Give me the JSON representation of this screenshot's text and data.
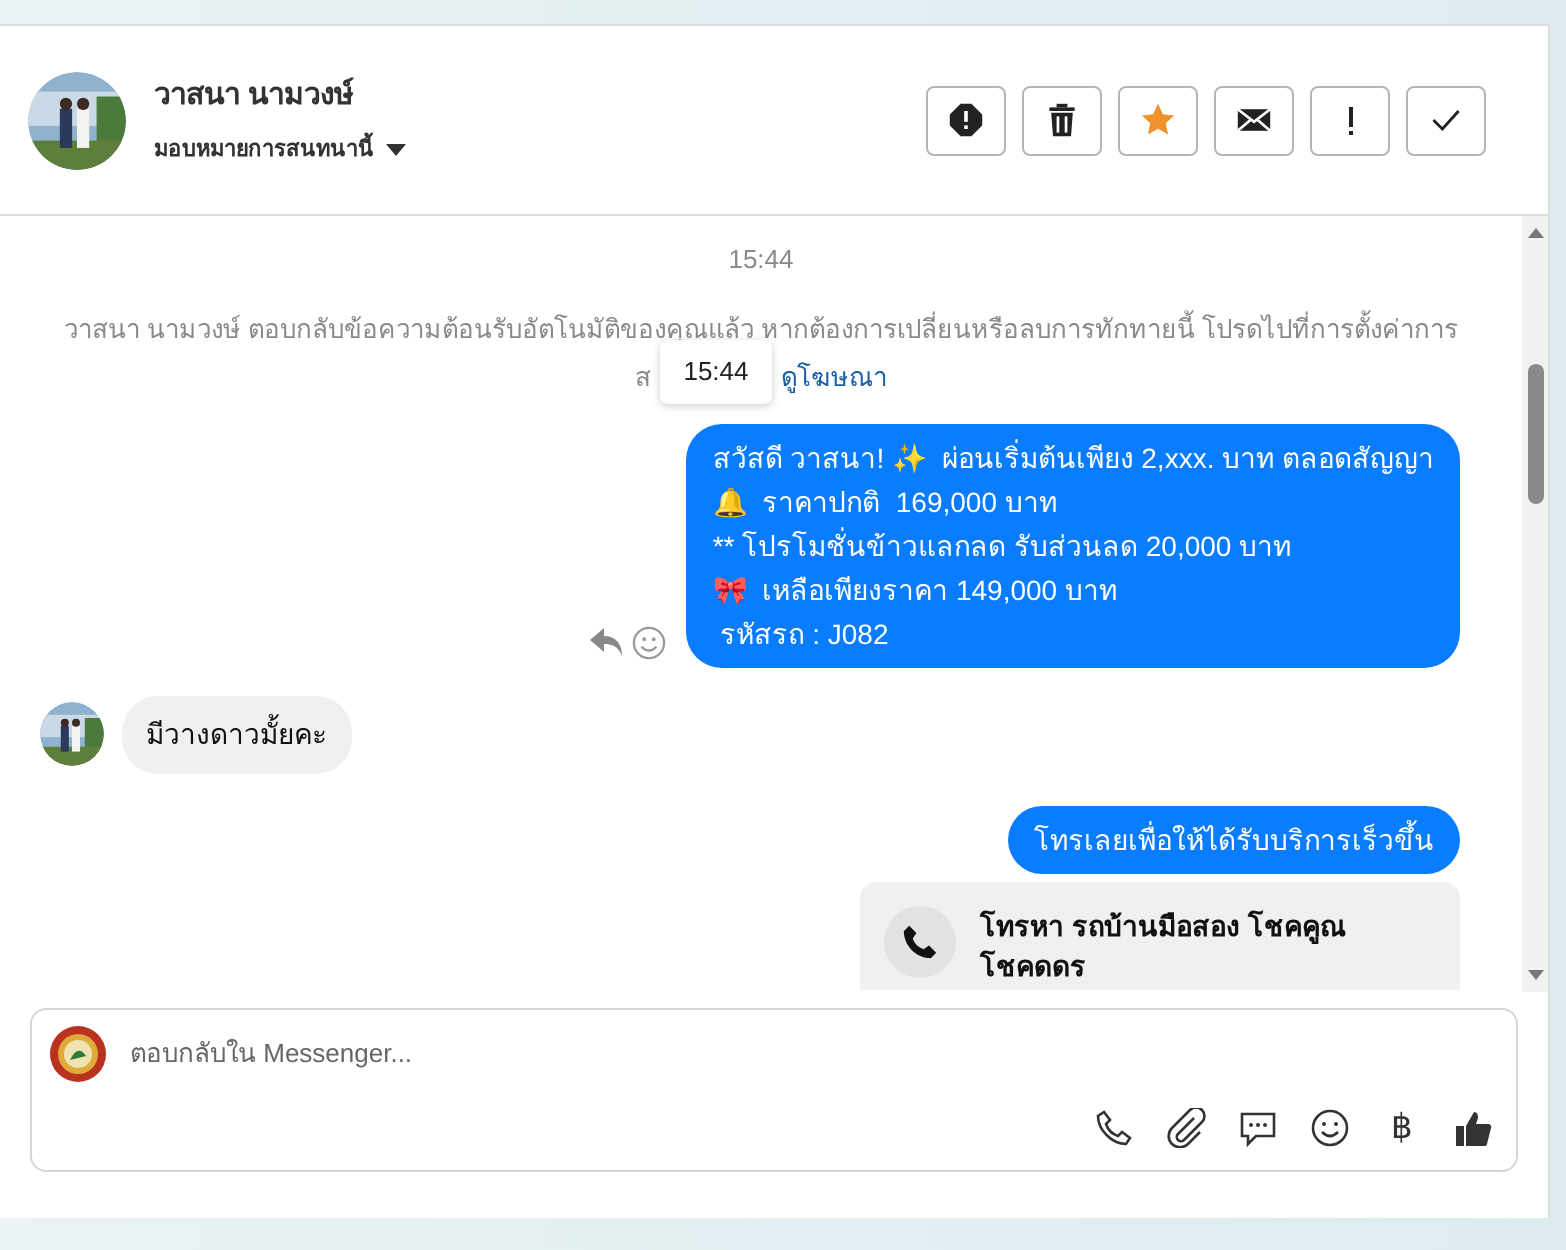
{
  "header": {
    "name": "วาสนา นามวงษ์",
    "assign": "มอบหมายการสนทนานี้",
    "actions": [
      {
        "kind": "report"
      },
      {
        "kind": "trash"
      },
      {
        "kind": "star"
      },
      {
        "kind": "mail"
      },
      {
        "kind": "important"
      },
      {
        "kind": "done"
      }
    ]
  },
  "chat": {
    "timestamp": "15:44",
    "notice": {
      "line1": "วาสนา นามวงษ์ ตอบกลับข้อความต้อนรับอัตโนมัติของคุณแล้ว หากต้องการเปลี่ยนหรือลบการทักทายนี้ โปรดไปที่การตั้งค่าการ",
      "line2_start": "ส",
      "link": "ดูโฆษณา",
      "tooltip": "15:44"
    },
    "messages": [
      {
        "kind": "outgoing",
        "lines": [
          "สวัสดี วาสนา! ✨  ผ่อนเริ่มต้นเพียง 2,xxx. บาท ตลอดสัญญา",
          "🔔  ราคาปกติ  169,000 บาท",
          "** โปรโมชั่นข้าวแลกลด รับส่วนลด 20,000 บาท",
          "🎀  เหลือเพียงราคา 149,000 บาท",
          " รหัสรถ : J082"
        ],
        "actions": true
      },
      {
        "kind": "incoming",
        "lines": [
          "มีวางดาวมั้ยคะ"
        ]
      },
      {
        "kind": "outgoing",
        "lines": [
          "โทรเลยเพื่อให้ได้รับบริการเร็วขึ้น"
        ]
      },
      {
        "kind": "call_card",
        "lines": [
          "โทรหา รถบ้านมือสอง โชคคูณ",
          "โชคดดร"
        ]
      }
    ]
  },
  "composer": {
    "placeholder": "ตอบกลับใน Messenger...",
    "tools": [
      {
        "kind": "phone"
      },
      {
        "kind": "clip"
      },
      {
        "kind": "chat"
      },
      {
        "kind": "emoji"
      },
      {
        "kind": "text",
        "label": "฿"
      },
      {
        "kind": "like"
      }
    ]
  }
}
